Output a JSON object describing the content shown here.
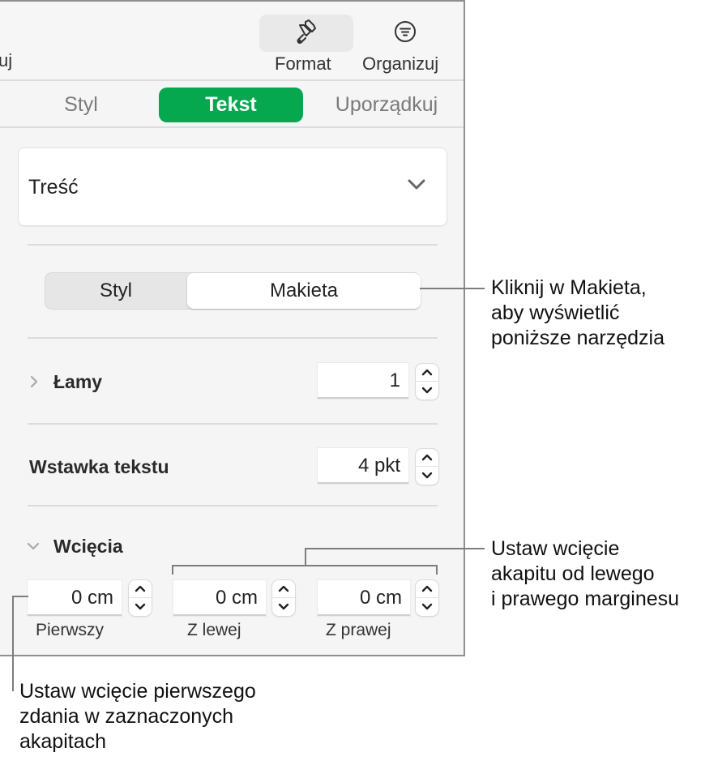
{
  "toolbar": {
    "cut_label": "uj",
    "format": {
      "label": "Format",
      "icon": "paintbrush-icon"
    },
    "organize": {
      "label": "Organizuj",
      "icon": "sort-filter-icon"
    }
  },
  "tabs": [
    {
      "label": "Styl",
      "active": false
    },
    {
      "label": "Tekst",
      "active": true
    },
    {
      "label": "Uporządkuj",
      "active": false
    }
  ],
  "accent_color": "#05a84f",
  "paragraph_style": {
    "value": "Treść",
    "icon": "chevron-down-icon"
  },
  "segmented": [
    {
      "label": "Styl",
      "selected": false
    },
    {
      "label": "Makieta",
      "selected": true
    }
  ],
  "columns": {
    "label": "Łamy",
    "value": "1",
    "expanded": false
  },
  "text_inset": {
    "label": "Wstawka tekstu",
    "value": "4 pkt"
  },
  "indents": {
    "label": "Wcięcia",
    "expanded": true,
    "fields": [
      {
        "value": "0 cm",
        "label": "Pierwszy"
      },
      {
        "value": "0 cm",
        "label": "Z lewej"
      },
      {
        "value": "0 cm",
        "label": "Z prawej"
      }
    ]
  },
  "callouts": {
    "makieta": [
      "Kliknij w Makieta,",
      "aby wyświetlić",
      "poniższe narzędzia"
    ],
    "left_right": [
      "Ustaw wcięcie",
      "akapitu od lewego",
      "i prawego marginesu"
    ],
    "first": [
      "Ustaw wcięcie pierwszego",
      "zdania w zaznaczonych",
      "akapitach"
    ]
  }
}
